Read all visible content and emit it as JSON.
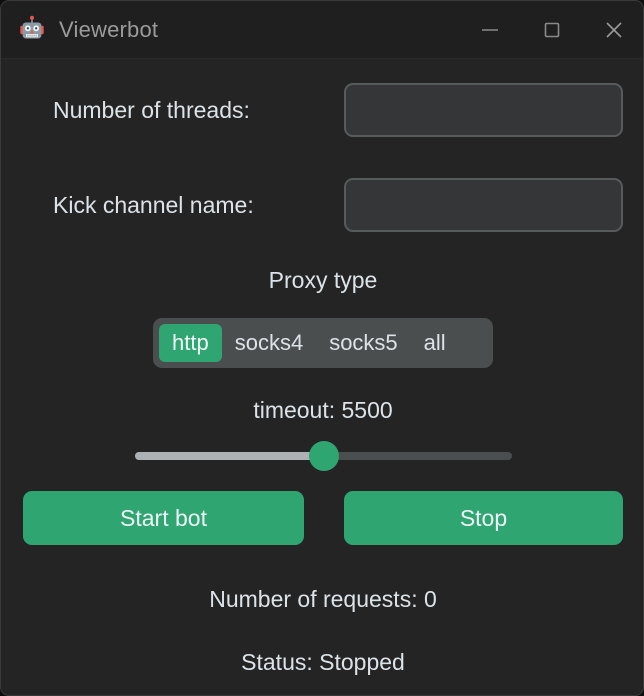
{
  "window": {
    "title": "Viewerbot",
    "icon": "robot-icon",
    "controls": {
      "minimize": "minimize-icon",
      "maximize": "maximize-icon",
      "close": "close-icon"
    }
  },
  "form": {
    "threads": {
      "label": "Number of threads:",
      "value": "",
      "placeholder": ""
    },
    "channel": {
      "label": "Kick channel name:",
      "value": "",
      "placeholder": ""
    }
  },
  "proxy": {
    "label": "Proxy type",
    "options": [
      "http",
      "socks4",
      "socks5",
      "all"
    ],
    "selected": "http"
  },
  "timeout": {
    "label": "timeout: 5500",
    "value": 5500,
    "percent": 50
  },
  "actions": {
    "start": "Start bot",
    "stop": "Stop"
  },
  "status": {
    "requests": "Number of requests: 0",
    "state": "Status: Stopped"
  },
  "colors": {
    "accent": "#2fa572",
    "window_bg": "#242424",
    "titlebar_bg": "#1f1f1f",
    "text": "#dce3e8",
    "title_text": "#9b9b9b",
    "input_bg": "#343638",
    "input_border": "#585b5c",
    "segmented_bg": "#4b4e4f",
    "slider_fill": "#aeb1b4",
    "slider_track": "#4b4e4f"
  }
}
